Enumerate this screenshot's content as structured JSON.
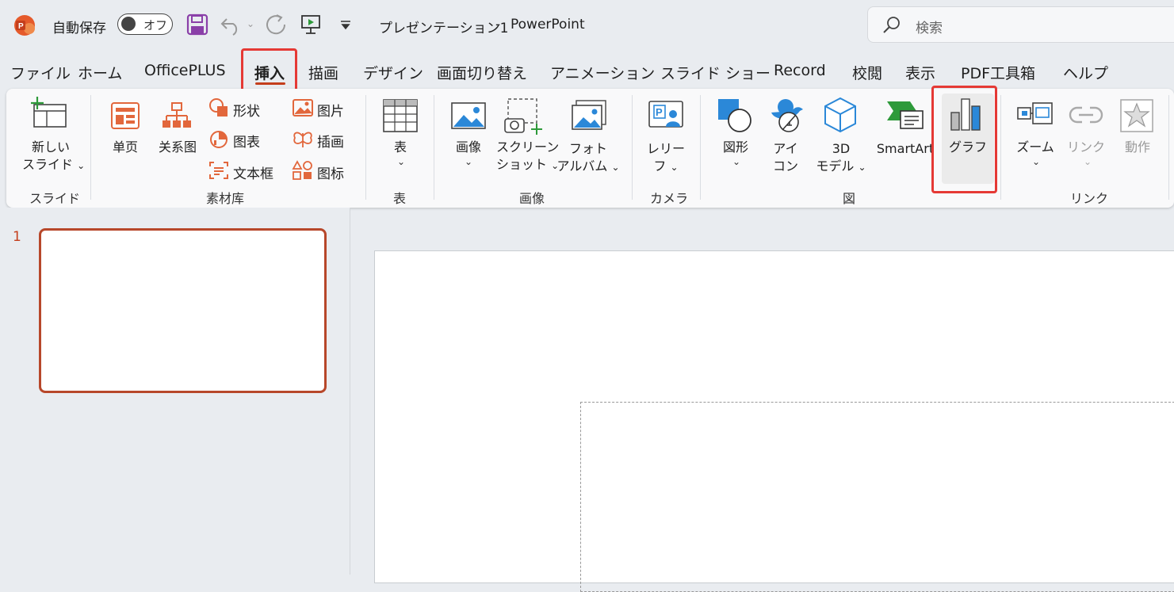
{
  "titlebar": {
    "autosave_label": "自動保存",
    "autosave_state": "オフ",
    "doc_title": "プレゼンテーション1",
    "title_sep": "-",
    "app_name": "PowerPoint",
    "search_placeholder": "検索"
  },
  "tabs": [
    {
      "label": "ファイル"
    },
    {
      "label": "ホーム"
    },
    {
      "label": "OfficePLUS"
    },
    {
      "label": "挿入",
      "active": true
    },
    {
      "label": "描画"
    },
    {
      "label": "デザイン"
    },
    {
      "label": "画面切り替え"
    },
    {
      "label": "アニメーション"
    },
    {
      "label": "スライド ショー"
    },
    {
      "label": "Record"
    },
    {
      "label": "校閲"
    },
    {
      "label": "表示"
    },
    {
      "label": "PDF工具箱"
    },
    {
      "label": "ヘルプ"
    }
  ],
  "ribbon": {
    "groups": {
      "slides": "スライド",
      "material": "素材库",
      "table": "表",
      "image": "画像",
      "camera": "カメラ",
      "figure": "図",
      "link": "リンク"
    },
    "buttons": {
      "new_slide_1": "新しい",
      "new_slide_2": "スライド",
      "single_page": "单页",
      "relation": "关系图",
      "shape_cn": "形状",
      "chart_cn": "图表",
      "textbox_cn": "文本框",
      "picture_cn": "图片",
      "illust_cn": "插画",
      "icon_cn": "图标",
      "table": "表",
      "image": "画像",
      "screenshot_1": "スクリーン",
      "screenshot_2": "ショット",
      "photo_1": "フォト",
      "photo_2": "アルバム",
      "cameo_1": "レリー",
      "cameo_2": "フ",
      "shapes": "図形",
      "icons_1": "アイ",
      "icons_2": "コン",
      "model_1": "3D",
      "model_2": "モデル",
      "smartart": "SmartArt",
      "chart": "グラフ",
      "zoom": "ズーム",
      "link": "リンク",
      "action": "動作"
    }
  },
  "slides": {
    "thumb_number": "1"
  },
  "colors": {
    "accent": "#c43e1c",
    "highlight": "#e53935",
    "icon_orange": "#e2673c",
    "icon_blue": "#2b88d8"
  }
}
